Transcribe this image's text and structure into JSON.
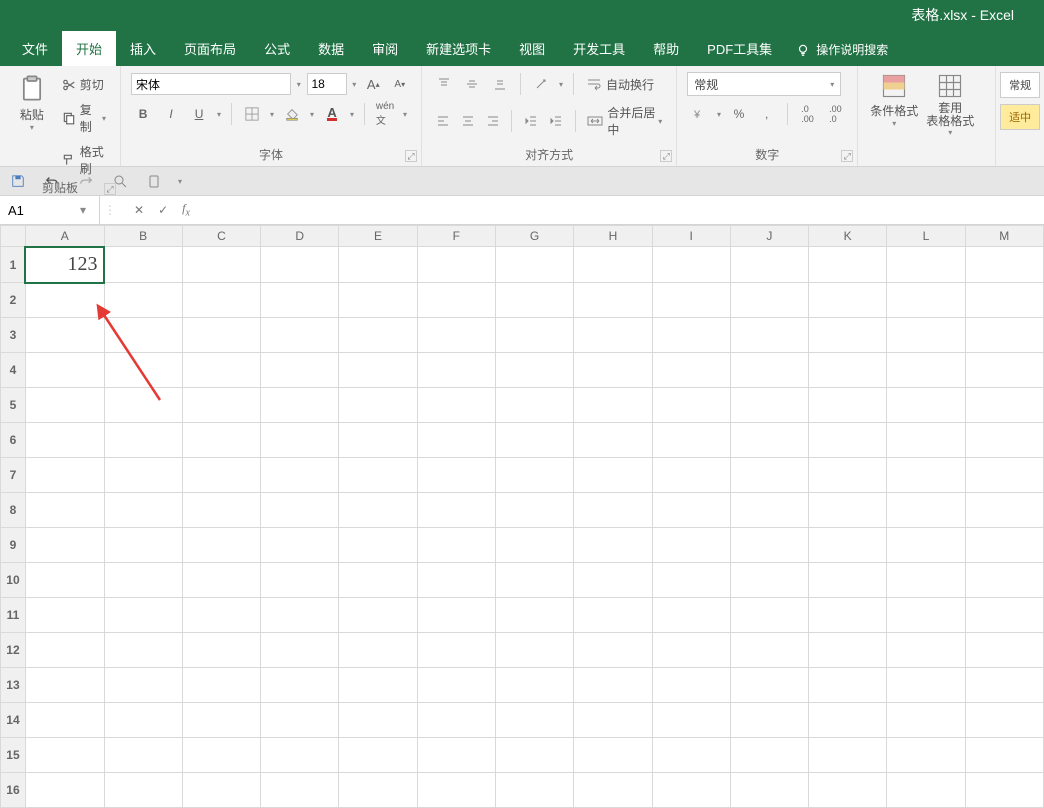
{
  "title": "表格.xlsx - Excel",
  "tabs": [
    "文件",
    "开始",
    "插入",
    "页面布局",
    "公式",
    "数据",
    "审阅",
    "新建选项卡",
    "视图",
    "开发工具",
    "帮助",
    "PDF工具集"
  ],
  "active_tab": "开始",
  "tell_me": "操作说明搜索",
  "ribbon": {
    "clipboard": {
      "paste": "粘贴",
      "cut": "剪切",
      "copy": "复制",
      "format_painter": "格式刷",
      "label": "剪贴板"
    },
    "font": {
      "name": "宋体",
      "size": "18",
      "bold": "B",
      "italic": "I",
      "underline": "U",
      "label": "字体"
    },
    "alignment": {
      "wrap": "自动换行",
      "merge": "合并后居中",
      "label": "对齐方式"
    },
    "number": {
      "format": "常规",
      "percent": "%",
      "comma": ",",
      "label": "数字"
    },
    "styles": {
      "cond": "条件格式",
      "table": "套用\n表格格式"
    },
    "right": {
      "normal": "常规",
      "fit": "适中"
    }
  },
  "name_box": "A1",
  "cells": {
    "A1": "123"
  },
  "columns": [
    "A",
    "B",
    "C",
    "D",
    "E",
    "F",
    "G",
    "H",
    "I",
    "J",
    "K",
    "L",
    "M"
  ],
  "rows": [
    "1",
    "2",
    "3",
    "4",
    "5",
    "6",
    "7",
    "8",
    "9",
    "10",
    "11",
    "12",
    "13",
    "14",
    "15",
    "16"
  ]
}
